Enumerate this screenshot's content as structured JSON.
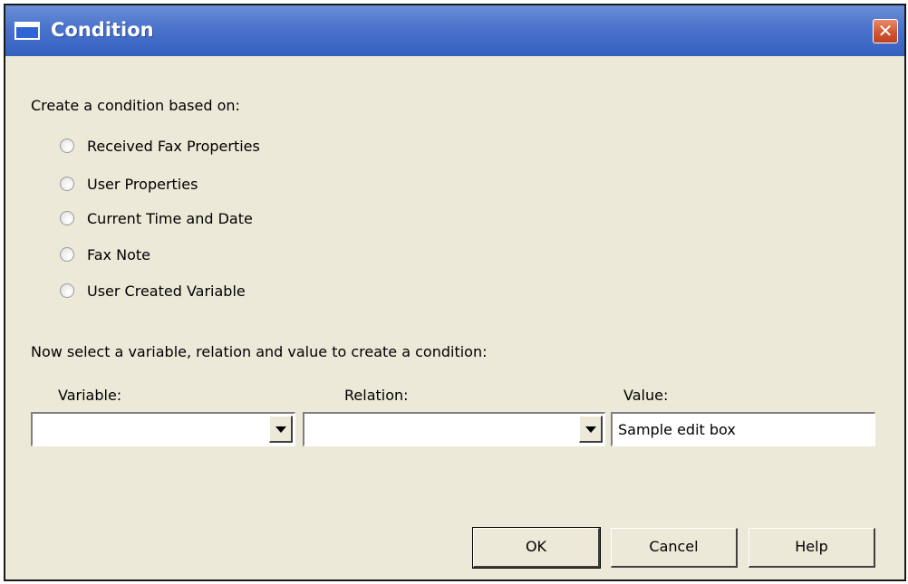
{
  "window": {
    "title": "Condition",
    "close_glyph": "✕"
  },
  "group_label": "Create a condition based on:",
  "options": [
    {
      "label": "Received Fax Properties",
      "selected": false
    },
    {
      "label": "User Properties",
      "selected": false
    },
    {
      "label": "Current Time and Date",
      "selected": false
    },
    {
      "label": "Fax Note",
      "selected": false
    },
    {
      "label": "User Created Variable",
      "selected": false
    }
  ],
  "instruction": "Now select a variable, relation and value to create a condition:",
  "fields": {
    "variable_label": "Variable:",
    "variable_value": "",
    "relation_label": "Relation:",
    "relation_value": "",
    "value_label": "Value:",
    "value_text": "Sample edit box"
  },
  "buttons": {
    "ok": "OK",
    "cancel": "Cancel",
    "help": "Help"
  },
  "icons": {
    "window": "window-icon",
    "close": "close-icon",
    "dropdown": "chevron-down-icon",
    "radio": "radio-icon"
  }
}
